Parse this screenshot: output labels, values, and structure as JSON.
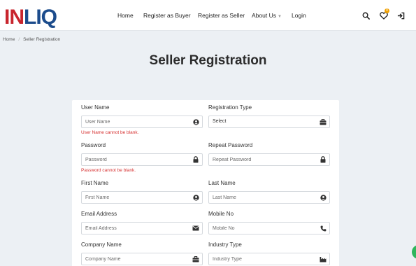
{
  "brand": {
    "part1": "IN",
    "part2": "LIQ"
  },
  "nav": {
    "home": "Home",
    "buyer": "Register as Buyer",
    "seller": "Register as Seller",
    "about": "About Us",
    "login": "Login"
  },
  "wishlist_count": "0",
  "breadcrumb": {
    "home": "Home",
    "current": "Seller Registration"
  },
  "page_title": "Seller Registration",
  "form": {
    "username": {
      "label": "User Name",
      "placeholder": "User Name",
      "error": "User Name cannot be blank."
    },
    "registration_type": {
      "label": "Registration Type",
      "value": "Select"
    },
    "password": {
      "label": "Password",
      "placeholder": "Password",
      "error": "Password cannot be blank."
    },
    "repeat_password": {
      "label": "Repeat Password",
      "placeholder": "Repeat Password"
    },
    "first_name": {
      "label": "First Name",
      "placeholder": "First Name"
    },
    "last_name": {
      "label": "Last Name",
      "placeholder": "Last Name"
    },
    "email": {
      "label": "Email Address",
      "placeholder": "Email Address"
    },
    "mobile": {
      "label": "Mobile No",
      "placeholder": "Mobile No"
    },
    "company": {
      "label": "Company Name",
      "placeholder": "Company Name"
    },
    "industry": {
      "label": "Industry Type",
      "placeholder": "Industry Type"
    }
  },
  "colors": {
    "brand_red": "#c8252d",
    "brand_blue": "#1c4c8c",
    "error": "#d63030",
    "badge": "#f0a000"
  }
}
